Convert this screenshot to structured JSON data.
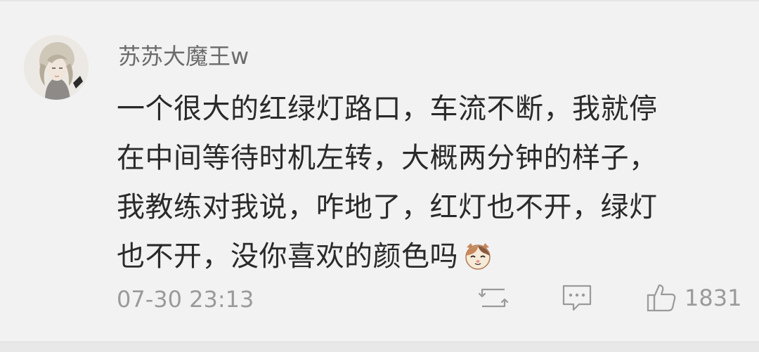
{
  "comment": {
    "username": "苏苏大魔王w",
    "lines": [
      "一个很大的红绿灯路口，车流不断，我就停",
      "在中间等待时机左转，大概两分钟的样子，",
      "我教练对我说，咋地了，红灯也不开，绿灯",
      "也不开，没你喜欢的颜色吗"
    ],
    "emoji": "cat-face-emoji",
    "timestamp": "07-30 23:13",
    "actions": {
      "repost_icon": "repost-icon",
      "reply_icon": "comment-icon",
      "like_icon": "thumbs-up-icon",
      "like_count": "1831"
    }
  },
  "colors": {
    "background": "#f2f2f2",
    "username": "#6b6b6b",
    "body_text": "#2a2a2a",
    "meta_text": "#9a9a9a"
  }
}
